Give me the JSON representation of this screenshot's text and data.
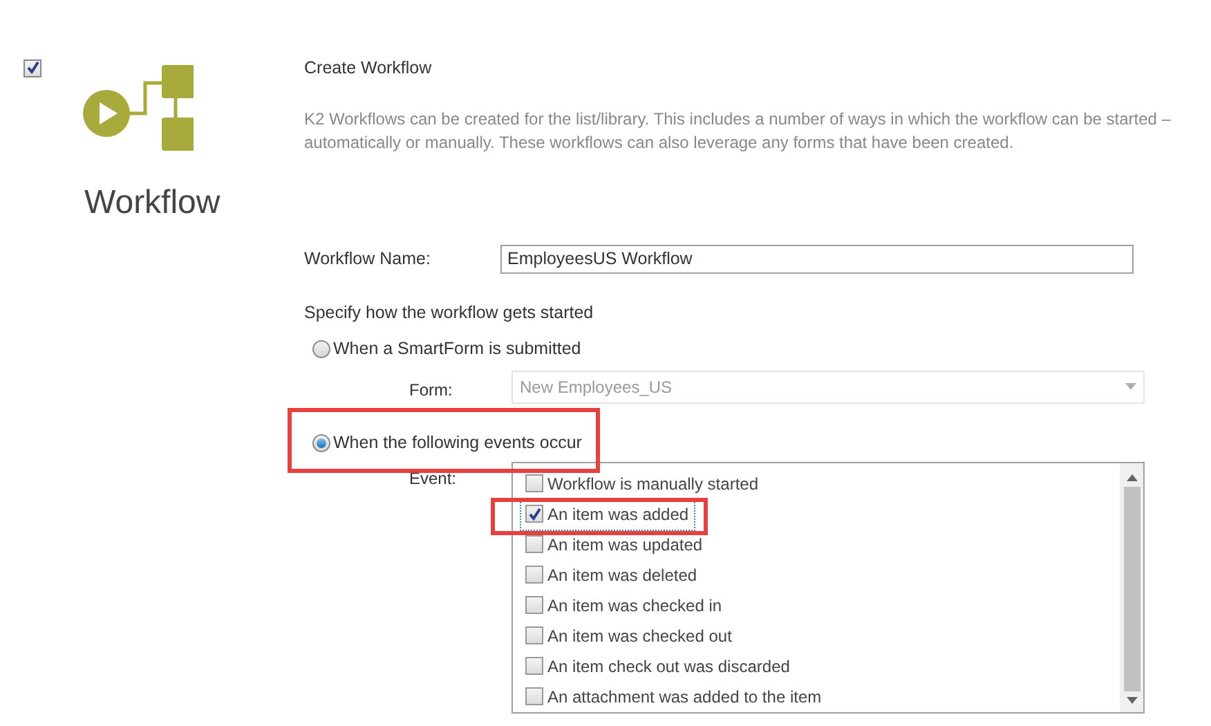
{
  "feature": {
    "checked": true,
    "title": "Workflow"
  },
  "heading": "Create Workflow",
  "description": "K2 Workflows can be created for the list/library.  This includes a number of ways in which the workflow can be started – automatically or manually.  These workflows can also leverage any forms that have been created.",
  "workflow_name": {
    "label": "Workflow Name:",
    "value": "EmployeesUS Workflow"
  },
  "start_prompt": "Specify how the workflow gets started",
  "start_options": [
    {
      "label": "When a SmartForm is submitted",
      "selected": false,
      "field_label": "Form:",
      "kind": "dropdown",
      "value": "New Employees_US",
      "disabled": true
    },
    {
      "label": "When the following events occur",
      "selected": true,
      "field_label": "Event:",
      "kind": "checklist",
      "items": [
        {
          "label": "Workflow is manually started",
          "checked": false,
          "focused": false
        },
        {
          "label": "An item was added",
          "checked": true,
          "focused": true
        },
        {
          "label": "An item was updated",
          "checked": false,
          "focused": false
        },
        {
          "label": "An item was deleted",
          "checked": false,
          "focused": false
        },
        {
          "label": "An item was checked in",
          "checked": false,
          "focused": false
        },
        {
          "label": "An item was checked out",
          "checked": false,
          "focused": false
        },
        {
          "label": "An item check out was discarded",
          "checked": false,
          "focused": false
        },
        {
          "label": "An attachment was added to the item",
          "checked": false,
          "focused": false
        }
      ]
    }
  ],
  "annotations": [
    {
      "kind": "frame"
    },
    {
      "kind": "frame"
    }
  ]
}
